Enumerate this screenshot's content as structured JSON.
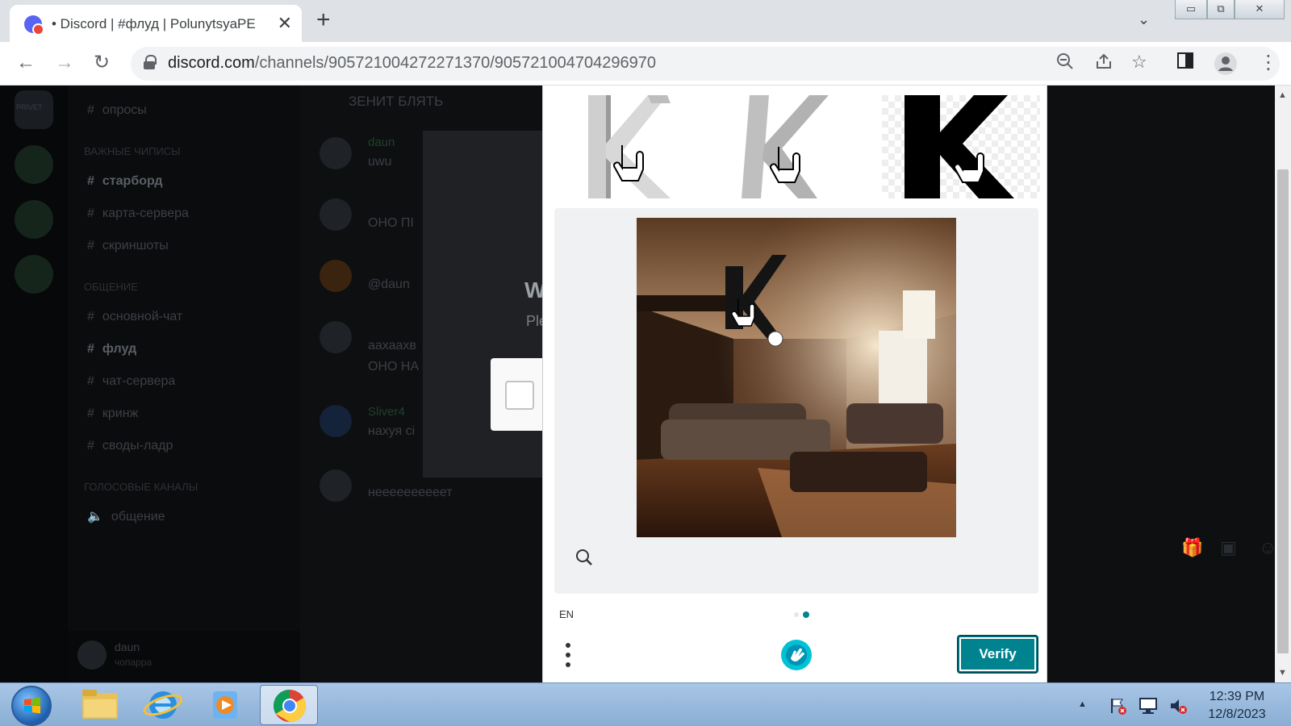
{
  "browser": {
    "tab": {
      "title": "• Discord | #флуд | PolunytsyaPE",
      "close": "✕"
    },
    "new_tab": "+",
    "tab_search": "⌄",
    "window_controls": {
      "minimize": "▭",
      "restore": "⧉",
      "close": "✕"
    },
    "nav": {
      "back": "←",
      "forward": "→",
      "reload": "↻"
    },
    "address": {
      "host": "discord.com",
      "path": "/channels/905721004272271370/905721004704296970"
    },
    "omnibox_icons": {
      "zoom": "zoom-out-icon",
      "share": "share-icon",
      "bookmark": "☆"
    },
    "side_panel": "▯",
    "profile": "profile-icon",
    "menu": "⋮"
  },
  "discord": {
    "server_banner": "PRIVET",
    "categories": [
      {
        "label": "важные чиписы"
      },
      {
        "label": "общение"
      },
      {
        "label": "голосовые каналы"
      }
    ],
    "channels": [
      {
        "label": "опросы"
      },
      {
        "label": "старборд"
      },
      {
        "label": "карта-сервера"
      },
      {
        "label": "скриншоты"
      },
      {
        "label": "основной-чат"
      },
      {
        "label": "флуд"
      },
      {
        "label": "чат-сервера"
      },
      {
        "label": "кринж"
      },
      {
        "label": "своды-ладр"
      },
      {
        "label": "общение"
      }
    ],
    "user": {
      "name": "daun",
      "status": "чопарра"
    },
    "chat_header": "ЗЕНИТ БЛЯТЬ",
    "messages": [
      {
        "name": "daun",
        "text": "uwu"
      },
      {
        "name": "",
        "text": "ОНО ПІ"
      },
      {
        "name": "",
        "text": "@daun"
      },
      {
        "name": "",
        "text": "аахаахв"
      },
      {
        "name": "",
        "text": "ОНО НА"
      },
      {
        "name": "Sliver4",
        "text": "нахуя сі"
      },
      {
        "name": "",
        "text": "неееееееееет"
      }
    ],
    "modal": {
      "title": "W",
      "subtitle": "Ple"
    }
  },
  "captcha": {
    "language": "EN",
    "verify_label": "Verify",
    "task_image": "living-room-with-letter-k",
    "colors": {
      "accent": "#00838f",
      "panel": "#f0f1f2"
    }
  },
  "taskbar": {
    "clock_time": "12:39 PM",
    "clock_date": "12/8/2023",
    "tray_up": "▲",
    "apps": [
      "file-explorer-icon",
      "internet-explorer-icon",
      "media-player-icon",
      "chrome-icon"
    ]
  }
}
